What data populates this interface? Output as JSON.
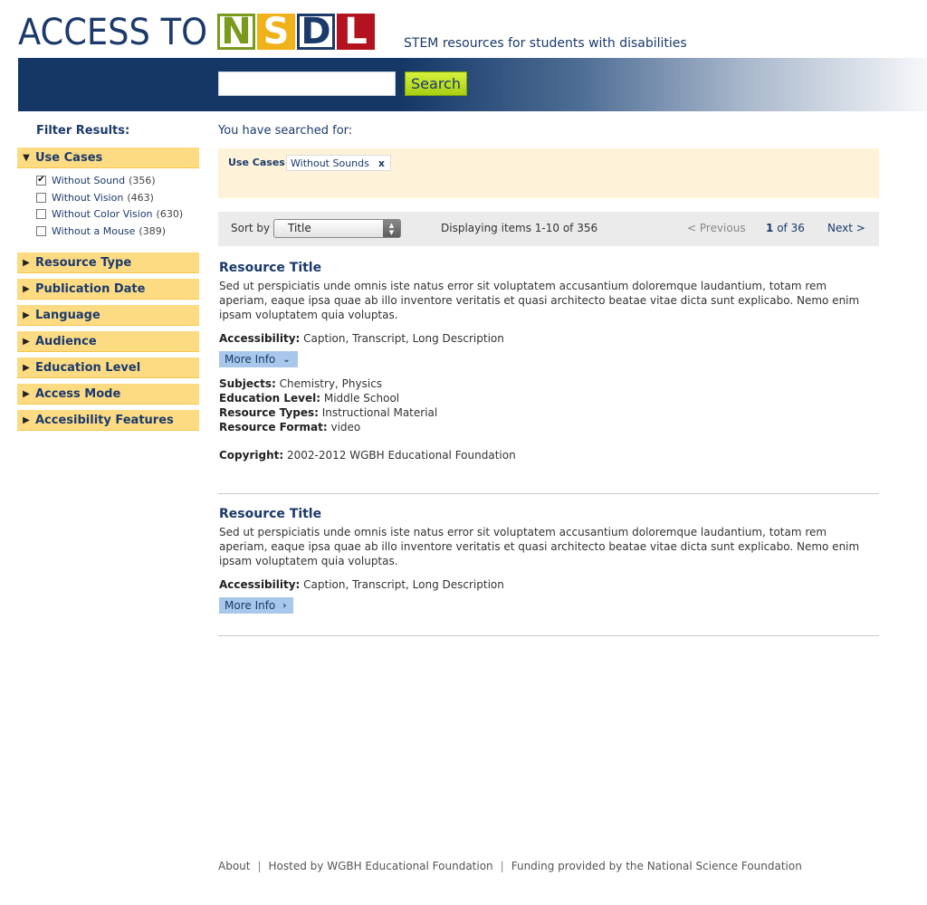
{
  "header": {
    "logo_text": "ACCESS TO",
    "logo_letters": [
      "N",
      "S",
      "D",
      "L"
    ],
    "tagline": "STEM resources for students with disabilities",
    "search_placeholder": "",
    "search_button": "Search"
  },
  "sidebar": {
    "title": "Filter Results:",
    "use_cases": {
      "label": "Use Cases",
      "options": [
        {
          "label": "Without Sound",
          "count": "(356)",
          "checked": true
        },
        {
          "label": "Without Vision",
          "count": "(463)",
          "checked": false
        },
        {
          "label": "Without Color Vision",
          "count": "(630)",
          "checked": false
        },
        {
          "label": "Without a Mouse",
          "count": "(389)",
          "checked": false
        }
      ]
    },
    "facets": [
      "Resource Type",
      "Publication Date",
      "Language",
      "Audience",
      "Education Level",
      "Access Mode",
      "Accesibility Features"
    ]
  },
  "main": {
    "searched_for": "You have searched for:",
    "query": {
      "label": "Use Cases:",
      "tag": "Without Sounds",
      "remove": "x"
    },
    "toolbar": {
      "sort_label": "Sort by",
      "sort_value": "Title",
      "display_info": "Displaying items 1-10 of 356",
      "prev": "< Previous",
      "page_current": "1",
      "page_of": "of 36",
      "next": "Next >"
    },
    "results": [
      {
        "title": "Resource Title",
        "description": "Sed ut perspiciatis unde omnis iste natus error sit voluptatem accusantium doloremque laudantium, totam rem aperiam, eaque ipsa quae ab illo inventore veritatis et quasi architecto beatae vitae dicta sunt explicabo. Nemo enim ipsam voluptatem quia voluptas.",
        "accessibility_label": "Accessibility:",
        "accessibility": "Caption, Transcript, Long Description",
        "more_info": "More Info",
        "expanded": true,
        "subjects_label": "Subjects:",
        "subjects": "Chemistry, Physics",
        "education_label": "Education Level:",
        "education": "Middle School",
        "types_label": "Resource Types:",
        "types": "Instructional Material",
        "format_label": "Resource Format:",
        "format": "video",
        "copyright_label": "Copyright:",
        "copyright": "2002-2012 WGBH Educational Foundation"
      },
      {
        "title": "Resource Title",
        "description": "Sed ut perspiciatis unde omnis iste natus error sit voluptatem accusantium doloremque laudantium, totam rem aperiam, eaque ipsa quae ab illo inventore veritatis et quasi architecto beatae vitae dicta sunt explicabo. Nemo enim ipsam voluptatem quia voluptas.",
        "accessibility_label": "Accessibility:",
        "accessibility": "Caption, Transcript, Long Description",
        "more_info": "More Info",
        "expanded": false
      }
    ]
  },
  "footer": {
    "about": "About",
    "hosted": "Hosted by WGBH Educational Foundation",
    "funding": "Funding provided by the National Science Foundation"
  },
  "colors": {
    "brand_navy": "#1b3a6b",
    "facet_bg": "#fddb83",
    "query_bg": "#fef3d8",
    "search_button": "#b8dc1e",
    "more_info_bg": "#a8c7ea"
  }
}
